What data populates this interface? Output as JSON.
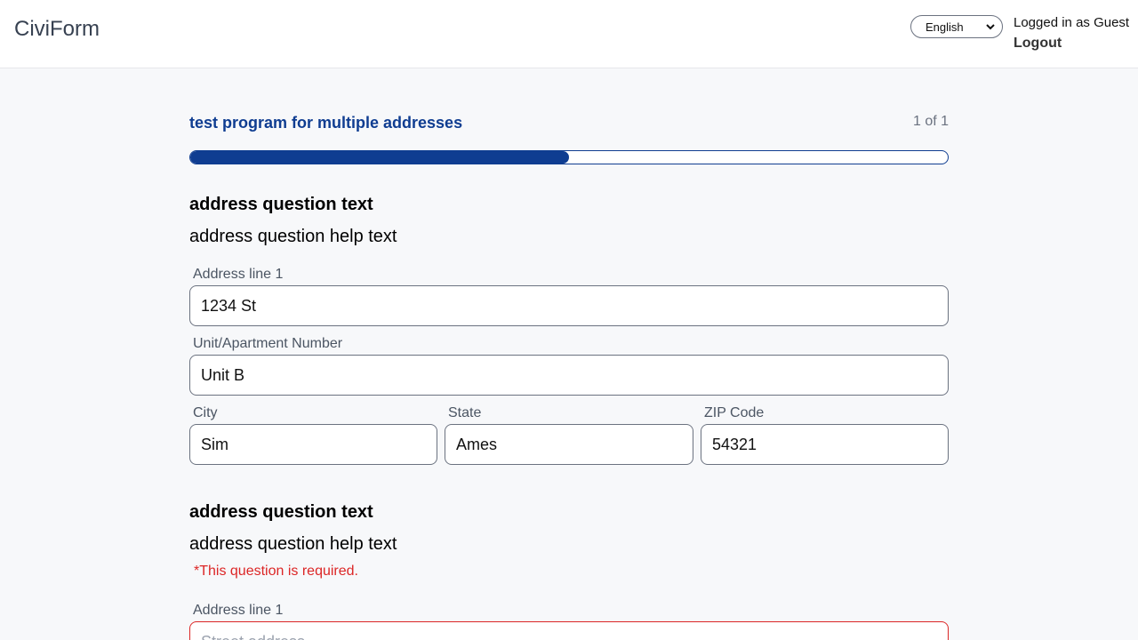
{
  "header": {
    "logo": "CiviForm",
    "language": "English",
    "user_status": "Logged in as Guest",
    "logout": "Logout"
  },
  "program": {
    "title": "test program for multiple addresses",
    "block_count": "1 of 1",
    "progress_fraction": 0.5
  },
  "questions": [
    {
      "text": "address question text",
      "help": "address question help text",
      "fields": {
        "address_line_1": {
          "label": "Address line 1",
          "value": "1234 St"
        },
        "unit": {
          "label": "Unit/Apartment Number",
          "value": "Unit B"
        },
        "city": {
          "label": "City",
          "value": "Sim"
        },
        "state": {
          "label": "State",
          "value": "Ames"
        },
        "zip": {
          "label": "ZIP Code",
          "value": "54321"
        }
      }
    },
    {
      "text": "address question text",
      "help": "address question help text",
      "error": "*This question is required.",
      "fields": {
        "address_line_1": {
          "label": "Address line 1",
          "placeholder": "Street address"
        }
      }
    }
  ],
  "colors": {
    "primary": "#0f3d91",
    "error": "#dc2626",
    "background": "#f7f8fa"
  },
  "icons": {
    "select_arrow": "chevron-down-icon"
  }
}
